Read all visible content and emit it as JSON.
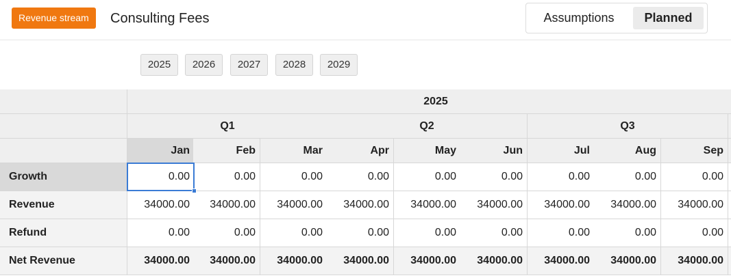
{
  "header": {
    "badge": "Revenue stream",
    "title": "Consulting Fees",
    "toggle": [
      "Assumptions",
      "Planned"
    ],
    "toggle_active": "Planned"
  },
  "years": [
    "2025",
    "2026",
    "2027",
    "2028",
    "2029"
  ],
  "table": {
    "year": "2025",
    "quarters": [
      "Q1",
      "Q2",
      "Q3"
    ],
    "months": [
      "Jan",
      "Feb",
      "Mar",
      "Apr",
      "May",
      "Jun",
      "Jul",
      "Aug",
      "Sep"
    ],
    "selected_cell": {
      "row": "Growth",
      "month": "Jan"
    },
    "rows": [
      {
        "label": "Growth",
        "values": [
          "0.00",
          "0.00",
          "0.00",
          "0.00",
          "0.00",
          "0.00",
          "0.00",
          "0.00",
          "0.00"
        ]
      },
      {
        "label": "Revenue",
        "values": [
          "34000.00",
          "34000.00",
          "34000.00",
          "34000.00",
          "34000.00",
          "34000.00",
          "34000.00",
          "34000.00",
          "34000.00"
        ]
      },
      {
        "label": "Refund",
        "values": [
          "0.00",
          "0.00",
          "0.00",
          "0.00",
          "0.00",
          "0.00",
          "0.00",
          "0.00",
          "0.00"
        ]
      },
      {
        "label": "Net Revenue",
        "values": [
          "34000.00",
          "34000.00",
          "34000.00",
          "34000.00",
          "34000.00",
          "34000.00",
          "34000.00",
          "34000.00",
          "34000.00"
        ]
      }
    ]
  },
  "colors": {
    "badge": "#f07810",
    "selection": "#3a7bd5",
    "header_bg": "#efefef"
  }
}
